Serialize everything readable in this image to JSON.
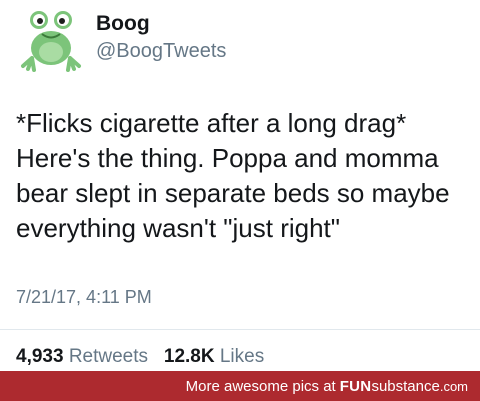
{
  "tweet": {
    "author_name": "Boog",
    "author_handle": "@BoogTweets",
    "avatar_icon": "frog-icon",
    "body_lines": [
      "*Flicks cigarette after a long drag*",
      "Here's the thing. Poppa and momma",
      "bear slept in separate beds so maybe",
      "everything wasn't \"just right\""
    ],
    "timestamp": "7/21/17, 4:11 PM",
    "retweets_count": "4,933",
    "retweets_label": "Retweets",
    "likes_count": "12.8K",
    "likes_label": "Likes"
  },
  "footer": {
    "prefix": "More awesome pics at",
    "brand_strong": "FUN",
    "brand_light": "substance",
    "brand_tld": ".com",
    "background_color": "#ad2a2f"
  }
}
